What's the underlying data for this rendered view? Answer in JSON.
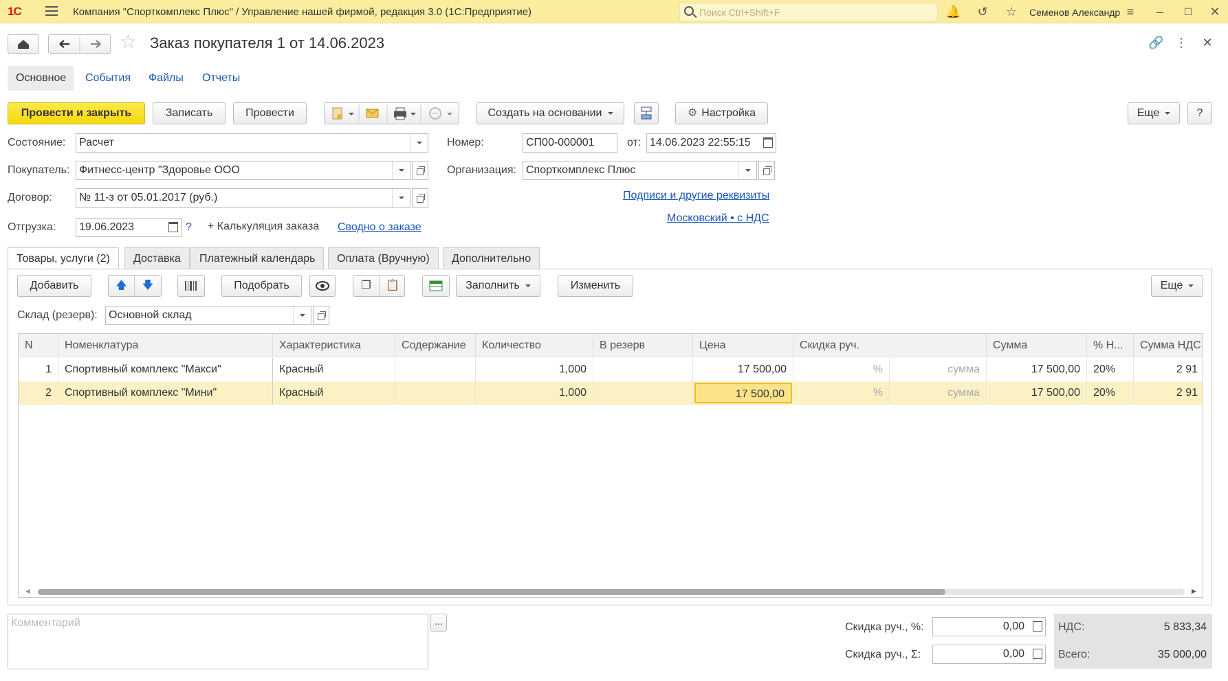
{
  "titlebar": {
    "logo": "1С",
    "app_title": "Компания \"Спорткомплекс Плюс\" / Управление нашей фирмой, редакция 3.0  (1С:Предприятие)",
    "search_placeholder": "Поиск Ctrl+Shift+F",
    "user": "Семенов Александр"
  },
  "header": {
    "title": "Заказ покупателя 1 от 14.06.2023"
  },
  "page_tabs": [
    "Основное",
    "События",
    "Файлы",
    "Отчеты"
  ],
  "toolbar": {
    "post_close": "Провести и закрыть",
    "save": "Записать",
    "post": "Провести",
    "create_based": "Создать на основании",
    "settings": "Настройка",
    "more": "Еще",
    "help": "?"
  },
  "form": {
    "state_label": "Состояние:",
    "state_value": "Расчет",
    "buyer_label": "Покупатель:",
    "buyer_value": "Фитнесс-центр \"Здоровье ООО",
    "contract_label": "Договор:",
    "contract_value": "№ 11-з от 05.01.2017 (руб.)",
    "shipment_label": "Отгрузка:",
    "shipment_value": "19.06.2023",
    "shipment_help": "?",
    "calc_link": "+ Калькуляция заказа",
    "summary_link": "Сводно о заказе",
    "number_label": "Номер:",
    "number_value": "СП00-000001",
    "date_label": "от:",
    "date_value": "14.06.2023 22:55:15",
    "org_label": "Организация:",
    "org_value": "Спорткомплекс Плюс",
    "signatures_link": "Подписи и другие реквизиты",
    "tax_link": "Московский • с НДС"
  },
  "inner_tabs": [
    "Товары, услуги (2)",
    "Доставка",
    "Платежный календарь",
    "Оплата (Вручную)",
    "Дополнительно"
  ],
  "tab_toolbar": {
    "add": "Добавить",
    "pick": "Подобрать",
    "fill": "Заполнить",
    "change": "Изменить",
    "more": "Еще",
    "warehouse_label": "Склад (резерв):",
    "warehouse_value": "Основной склад"
  },
  "grid": {
    "columns": [
      "N",
      "Номенклатура",
      "Характеристика",
      "Содержание",
      "Количество",
      "В резерв",
      "Цена",
      "Скидка руч.",
      "Сумма",
      "% Н...",
      "Сумма НДС"
    ],
    "rows": [
      {
        "n": "1",
        "item": "Спортивный комплекс \"Макси\"",
        "char": "Красный",
        "content": "",
        "qty": "1,000",
        "reserve": "",
        "price": "17 500,00",
        "disc_pct": "%",
        "disc_sum": "сумма",
        "sum": "17 500,00",
        "vat_rate": "20%",
        "vat_sum": "2 91"
      },
      {
        "n": "2",
        "item": "Спортивный комплекс \"Мини\"",
        "char": "Красный",
        "content": "",
        "qty": "1,000",
        "reserve": "",
        "price": "17 500,00",
        "disc_pct": "%",
        "disc_sum": "сумма",
        "sum": "17 500,00",
        "vat_rate": "20%",
        "vat_sum": "2 91"
      }
    ]
  },
  "footer": {
    "comment_placeholder": "Комментарий",
    "comment_more": "...",
    "disc_pct_label": "Скидка руч., %:",
    "disc_pct_value": "0,00",
    "disc_sum_label": "Скидка руч., Σ:",
    "disc_sum_value": "0,00",
    "vat_label": "НДС:",
    "vat_value": "5 833,34",
    "total_label": "Всего:",
    "total_value": "35 000,00"
  }
}
